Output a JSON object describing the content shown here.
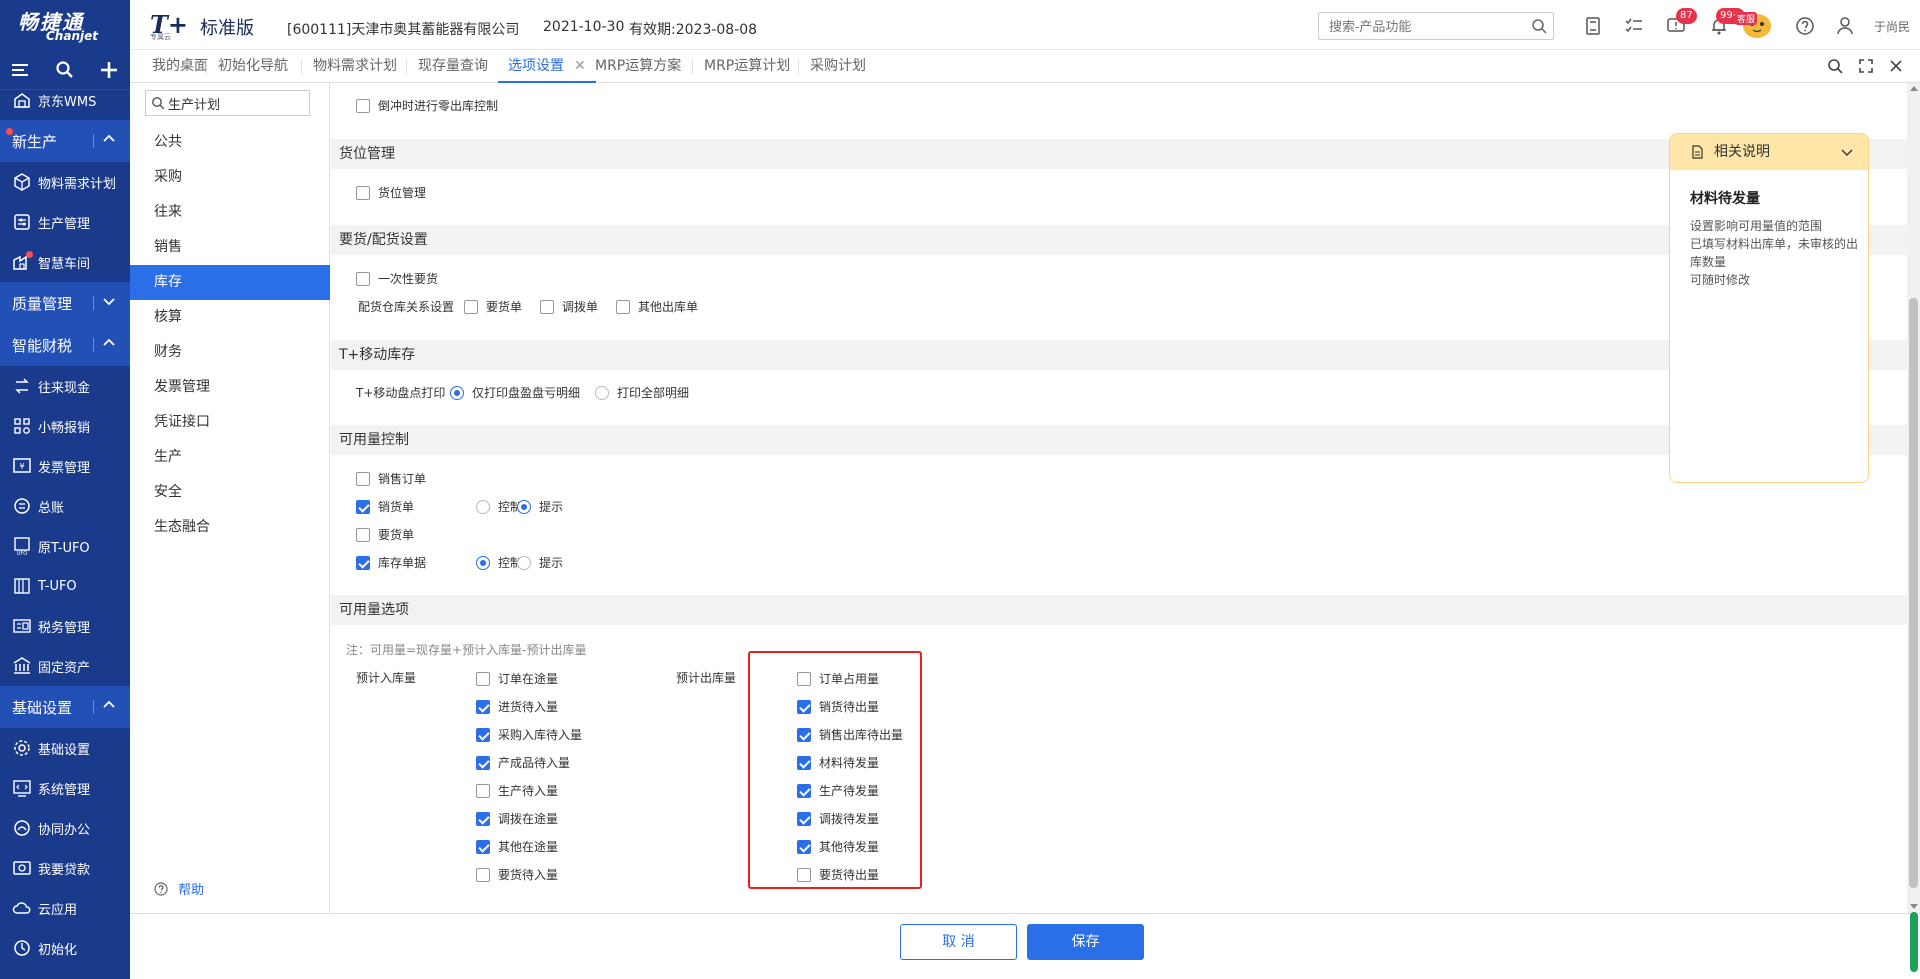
{
  "brand": {
    "name_cn": "畅捷通",
    "name_en": "Chanjet"
  },
  "header": {
    "product_logo": "T+",
    "product_sub": "专属云",
    "edition": "标准版",
    "company": "[600111]天津市奥其蓄能器有限公司",
    "date": "2021-10-30",
    "validity": "有效期:2023-08-08",
    "search_placeholder": "搜索-产品功能",
    "badge_messages": "87",
    "badge_notifications": "99+",
    "service_label": "客服",
    "username": "于尚民"
  },
  "sidebar": {
    "items": [
      {
        "label": "京东WMS",
        "icon": "warehouse-icon",
        "type": "item"
      },
      {
        "label": "新生产",
        "type": "group",
        "expanded": true,
        "dot": true
      },
      {
        "label": "物料需求计划",
        "icon": "cube-icon",
        "type": "item"
      },
      {
        "label": "生产管理",
        "icon": "sliders-icon",
        "type": "item"
      },
      {
        "label": "智慧车间",
        "icon": "factory-icon",
        "type": "item",
        "dot": true
      },
      {
        "label": "质量管理",
        "type": "group",
        "expanded": false
      },
      {
        "label": "智能财税",
        "type": "group",
        "expanded": true
      },
      {
        "label": "往来现金",
        "icon": "exchange-icon",
        "type": "item"
      },
      {
        "label": "小畅报销",
        "icon": "apps-icon",
        "type": "item"
      },
      {
        "label": "发票管理",
        "icon": "invoice-icon",
        "type": "item"
      },
      {
        "label": "总账",
        "icon": "ledger-icon",
        "type": "item"
      },
      {
        "label": "原T-UFO",
        "icon": "ufo-icon",
        "type": "item"
      },
      {
        "label": "T-UFO",
        "icon": "report-icon",
        "type": "item"
      },
      {
        "label": "税务管理",
        "icon": "tax-icon",
        "type": "item"
      },
      {
        "label": "固定资产",
        "icon": "bank-icon",
        "type": "item"
      },
      {
        "label": "基础设置",
        "type": "group",
        "expanded": true
      },
      {
        "label": "基础设置",
        "icon": "gear-icon",
        "type": "item"
      },
      {
        "label": "系统管理",
        "icon": "code-icon",
        "type": "item"
      },
      {
        "label": "协同办公",
        "icon": "collab-icon",
        "type": "item"
      },
      {
        "label": "我要贷款",
        "icon": "loan-icon",
        "type": "item"
      },
      {
        "label": "云应用",
        "icon": "cloud-icon",
        "type": "item"
      },
      {
        "label": "初始化",
        "icon": "init-icon",
        "type": "item"
      }
    ]
  },
  "tabs": [
    {
      "label": "我的桌面",
      "active": false
    },
    {
      "label": "初始化导航",
      "active": false
    },
    {
      "label": "物料需求计划",
      "active": false
    },
    {
      "label": "现存量查询",
      "active": false
    },
    {
      "label": "选项设置",
      "active": true,
      "closable": true
    },
    {
      "label": "MRP运算方案",
      "active": false
    },
    {
      "label": "MRP运算计划",
      "active": false
    },
    {
      "label": "采购计划",
      "active": false
    }
  ],
  "category": {
    "search_value": "生产计划",
    "items": [
      "公共",
      "采购",
      "往来",
      "销售",
      "库存",
      "核算",
      "财务",
      "发票管理",
      "凭证接口",
      "生产",
      "安全",
      "生态融合"
    ],
    "active_index": 4,
    "help": "帮助"
  },
  "content": {
    "top_option": {
      "label": "倒冲时进行零出库控制",
      "checked": false
    },
    "sections": {
      "location": {
        "title": "货位管理",
        "options": [
          {
            "label": "货位管理",
            "checked": false
          }
        ]
      },
      "request": {
        "title": "要货/配货设置",
        "one_time": {
          "label": "一次性要货",
          "checked": false
        },
        "relation_label": "配货仓库关系设置",
        "relation_options": [
          {
            "label": "要货单",
            "checked": false
          },
          {
            "label": "调拨单",
            "checked": false
          },
          {
            "label": "其他出库单",
            "checked": false
          }
        ]
      },
      "mobile": {
        "title": "T+移动库存",
        "print_label": "T+移动盘点打印",
        "radio_options": [
          {
            "label": "仅打印盘盈盘亏明细",
            "selected": true
          },
          {
            "label": "打印全部明细",
            "selected": false
          }
        ]
      },
      "control": {
        "title": "可用量控制",
        "rows": [
          {
            "label": "销售订单",
            "checked": false,
            "has_radio": false
          },
          {
            "label": "销货单",
            "checked": true,
            "has_radio": true,
            "radio": [
              {
                "label": "控制",
                "selected": false
              },
              {
                "label": "提示",
                "selected": true
              }
            ]
          },
          {
            "label": "要货单",
            "checked": false,
            "has_radio": false
          },
          {
            "label": "库存单据",
            "checked": true,
            "has_radio": true,
            "radio": [
              {
                "label": "控制",
                "selected": true
              },
              {
                "label": "提示",
                "selected": false
              }
            ]
          }
        ]
      },
      "availability": {
        "title": "可用量选项",
        "note": "注：可用量=现存量+预计入库量-预计出库量",
        "inbound_label": "预计入库量",
        "outbound_label": "预计出库量",
        "inbound": [
          {
            "label": "订单在途量",
            "checked": false
          },
          {
            "label": "进货待入量",
            "checked": true
          },
          {
            "label": "采购入库待入量",
            "checked": true
          },
          {
            "label": "产成品待入量",
            "checked": true
          },
          {
            "label": "生产待入量",
            "checked": false
          },
          {
            "label": "调拨在途量",
            "checked": true
          },
          {
            "label": "其他在途量",
            "checked": true
          },
          {
            "label": "要货待入量",
            "checked": false
          }
        ],
        "outbound": [
          {
            "label": "订单占用量",
            "checked": false
          },
          {
            "label": "销货待出量",
            "checked": true
          },
          {
            "label": "销售出库待出量",
            "checked": true
          },
          {
            "label": "材料待发量",
            "checked": true
          },
          {
            "label": "生产待发量",
            "checked": true
          },
          {
            "label": "调拨待发量",
            "checked": true
          },
          {
            "label": "其他待发量",
            "checked": true
          },
          {
            "label": "要货待出量",
            "checked": false
          }
        ]
      }
    }
  },
  "info_panel": {
    "header": "相关说明",
    "title": "材料待发量",
    "lines": [
      "设置影响可用量值的范围",
      "已填写材料出库单，未审核的出库数量",
      "可随时修改"
    ]
  },
  "footer": {
    "cancel": "取 消",
    "save": "保存"
  },
  "colors": {
    "sidebar_bg": "#1a3a8c",
    "sidebar_group": "#2350b5",
    "accent": "#2a6ee8",
    "highlight_box": "#e82020",
    "info_border": "#f7d48a"
  }
}
